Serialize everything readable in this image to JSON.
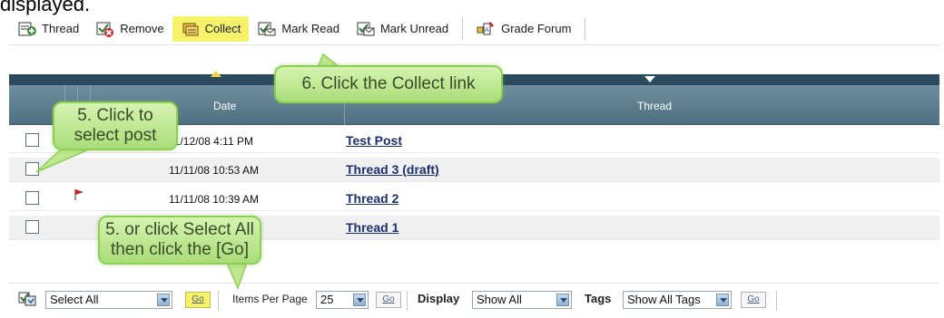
{
  "intro": {
    "text": "displayed."
  },
  "toolbar": {
    "items": [
      {
        "label": "Thread",
        "icon": "new-thread-icon"
      },
      {
        "label": "Remove",
        "icon": "remove-icon"
      },
      {
        "label": "Collect",
        "icon": "collect-icon",
        "highlighted": true
      },
      {
        "label": "Mark Read",
        "icon": "mark-read-icon"
      },
      {
        "label": "Mark Unread",
        "icon": "mark-unread-icon"
      },
      {
        "label": "Grade Forum",
        "icon": "grade-forum-icon"
      }
    ]
  },
  "table": {
    "columns": {
      "date": "Date",
      "thread": "Thread"
    },
    "rows": [
      {
        "date": "11/12/08 4:11 PM",
        "thread": "Test Post",
        "flagged": false
      },
      {
        "date": "11/11/08 10:53 AM",
        "thread": "Thread 3 (draft)",
        "flagged": false
      },
      {
        "date": "11/11/08 10:39 AM",
        "thread": "Thread 2",
        "flagged": true
      },
      {
        "date": "",
        "thread": "Thread 1",
        "flagged": false
      }
    ]
  },
  "bottombar": {
    "select_value": "Select All",
    "go_label": "Go",
    "items_per_page_label": "Items Per Page",
    "items_per_page_value": "25",
    "display_label": "Display",
    "display_value": "Show All",
    "tags_label": "Tags",
    "tags_value": "Show All Tags"
  },
  "callouts": {
    "collect": "6. Click the Collect link",
    "select_line1": "5. Click to",
    "select_line2": "select post",
    "select_all_line1": "5. or click Select All",
    "select_all_line2": "then click the [Go]"
  },
  "colors": {
    "header_bg": "#5f7f92",
    "highlight": "#f6f36a",
    "callout_fill": "#c3eb95",
    "link": "#1c2f6e"
  }
}
